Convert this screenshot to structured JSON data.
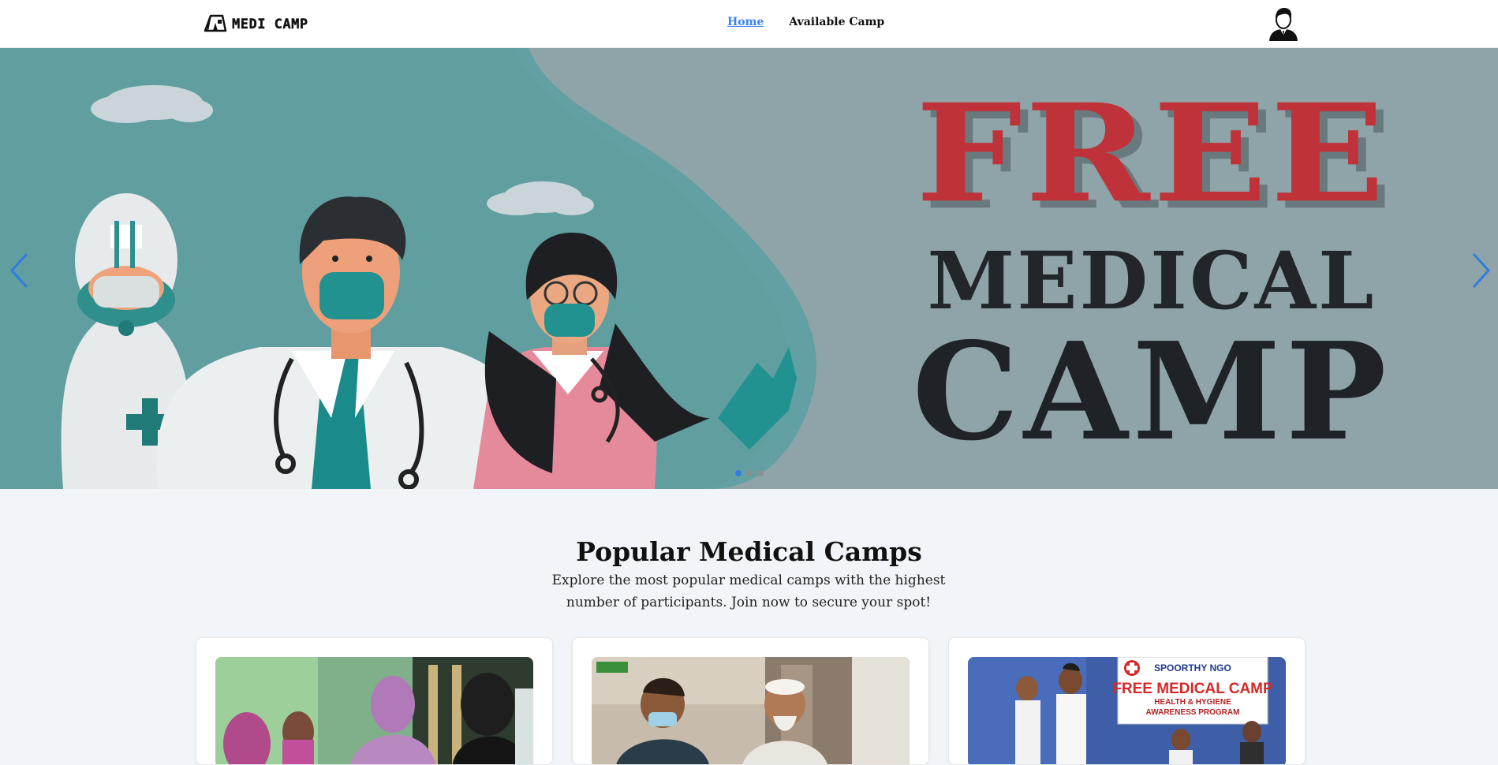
{
  "app": {
    "logo_text": "MEDI CAMP",
    "logo_icon": "tent-icon"
  },
  "nav": {
    "items": [
      {
        "label": "Home",
        "active": true
      },
      {
        "label": "Available Camp",
        "active": false
      }
    ]
  },
  "user": {
    "avatar_icon": "user-avatar-icon"
  },
  "hero": {
    "slides_total": 3,
    "active_slide": 1,
    "text": {
      "line1": "FREE",
      "line2": "MEDICAL",
      "line3": "CAMP"
    },
    "prev_icon": "chevron-left-icon",
    "next_icon": "chevron-right-icon"
  },
  "popular": {
    "title": "Popular Medical Camps",
    "subtitle": "Explore the most popular medical camps with the highest number of participants. Join now to secure your spot!",
    "cards": [
      {
        "image": "camp-photo-women-patients"
      },
      {
        "image": "camp-photo-doctor-elderly-man"
      },
      {
        "image": "camp-photo-free-medical-camp-banner",
        "banner": {
          "org": "SPOORTHY NGO",
          "headline": "FREE MEDICAL CAMP",
          "line1": "HEALTH & HYGIENE",
          "line2": "AWARENESS PROGRAM"
        }
      }
    ]
  },
  "colors": {
    "accent": "#3b82f6",
    "hero_red": "#c0323a",
    "hero_dark": "#1f2328",
    "page_bg": "#f1f4f8"
  }
}
